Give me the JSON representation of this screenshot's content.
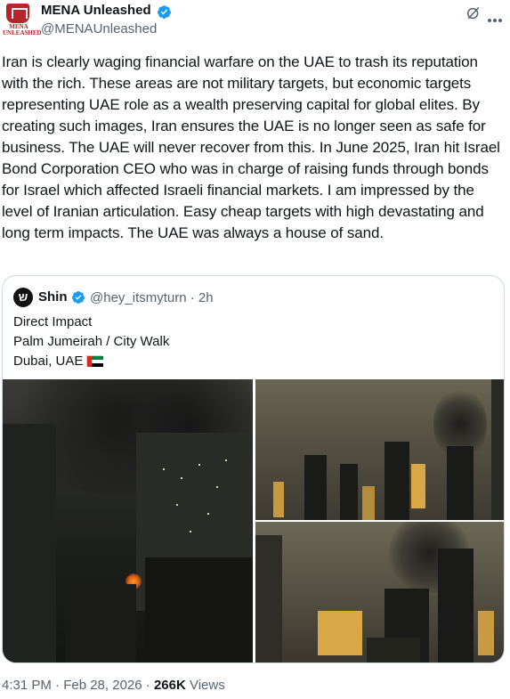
{
  "author": {
    "display_name": "MENA Unleashed",
    "handle": "@MENAUnleashed",
    "avatar_text": "MENA UNLEASHED"
  },
  "tweet": {
    "text": "Iran is clearly waging financial warfare on the UAE to trash its reputation with the rich. These areas are not military targets, but economic targets representing UAE role as a wealth preserving capital for global elites. By creating such images, Iran ensures the UAE is no longer seen as safe for business. The UAE will never recover from this. In June 2025, Iran hit Israel Bond Corporation CEO who was in charge of raising funds through bonds for Israel which affected Israeli financial markets. I am impressed by the level of Iranian articulation. Easy cheap targets with high devastating and long term impacts. The UAE was always a house of sand."
  },
  "quote": {
    "avatar_glyph": "ש",
    "display_name": "Shin",
    "handle_time": "@hey_itsmyturn · 2h",
    "lines": [
      "Direct Impact",
      "Palm Jumeirah / City Walk",
      "Dubai, UAE"
    ]
  },
  "footer": {
    "time_date": "4:31 PM · Feb 28, 2026 · ",
    "views_count": "266K",
    "views_label": " Views"
  },
  "colors": {
    "verified": "#1d9bf0",
    "brand": "#b3262c",
    "secondary_text": "#536471"
  },
  "icons": [
    "verified-badge-icon",
    "grok-icon",
    "more-options-icon",
    "uae-flag-icon"
  ]
}
